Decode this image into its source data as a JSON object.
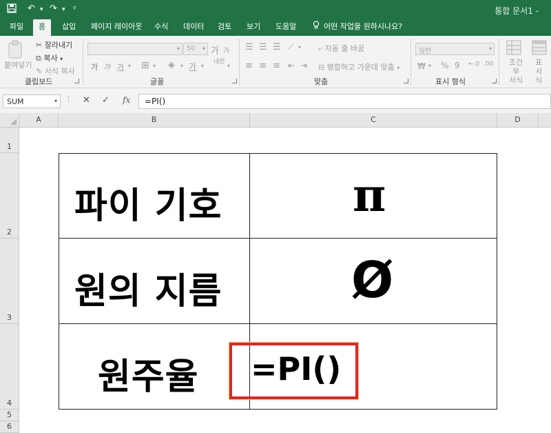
{
  "title_bar": {
    "save_icon": "save-icon",
    "undo_icon": "undo-icon",
    "redo_icon": "redo-icon",
    "document_title": "통합 문서1 -"
  },
  "tabs": [
    {
      "label": "파일",
      "active": false
    },
    {
      "label": "홈",
      "active": true
    },
    {
      "label": "삽입",
      "active": false
    },
    {
      "label": "페이지 레이아웃",
      "active": false
    },
    {
      "label": "수식",
      "active": false
    },
    {
      "label": "데이터",
      "active": false
    },
    {
      "label": "검토",
      "active": false
    },
    {
      "label": "보기",
      "active": false
    },
    {
      "label": "도움말",
      "active": false
    },
    {
      "label": "어떤 작업을 원하시나요?",
      "active": false
    }
  ],
  "ribbon": {
    "clipboard": {
      "paste": "붙여넣기",
      "cut": "잘라내기",
      "copy": "복사",
      "format_painter": "서식 복사",
      "label": "클립보드"
    },
    "font": {
      "font_name": "",
      "font_size": "50",
      "grow": "가",
      "shrink": "가",
      "bold": "가",
      "italic": "가",
      "underline": "가",
      "color": "가",
      "phonetic": "내천",
      "label": "글꼴"
    },
    "alignment": {
      "wrap_text": "자동 줄 바꿈",
      "merge_center": "병합하고 가운데 맞춤",
      "label": "맞춤"
    },
    "number": {
      "format": "일반",
      "percent": "%",
      "comma": "9",
      "label": "표시 형식"
    },
    "styles": {
      "conditional_line1": "조건부",
      "conditional_line2": "서식",
      "table_line1": "표",
      "table_line2": "서식"
    }
  },
  "formula_bar": {
    "name_box": "SUM",
    "cancel": "✕",
    "enter": "✓",
    "fx": "fx",
    "formula": "=PI()"
  },
  "columns": [
    "A",
    "B",
    "C",
    "D"
  ],
  "rows": [
    "1",
    "2",
    "3",
    "4",
    "5",
    "6"
  ],
  "table": [
    {
      "label": "파이 기호",
      "value": "π"
    },
    {
      "label": "원의 지름",
      "value": "Ø"
    },
    {
      "label": "원주율",
      "value": "=PI()"
    }
  ],
  "colors": {
    "excel_green": "#217346",
    "highlight": "#e3242b"
  }
}
